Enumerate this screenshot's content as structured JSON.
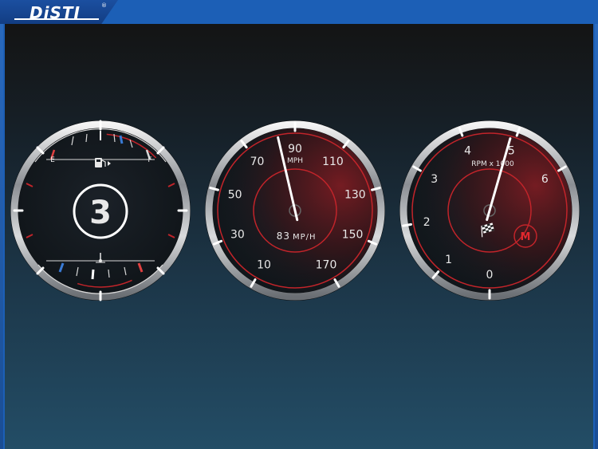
{
  "app": {
    "logo_text": "DiSTI",
    "logo_reg": "®"
  },
  "fuel_temp_gauge": {
    "fuel_empty_label": "E",
    "fuel_full_label": "F",
    "fuel_icon": "fuel-pump-icon",
    "temp_icon": "coolant-temperature-icon",
    "gear": "3"
  },
  "speedometer": {
    "unit_label": "MPH",
    "scale_labels": [
      "10",
      "30",
      "50",
      "70",
      "90",
      "110",
      "130",
      "150",
      "170"
    ],
    "readout_value": "83",
    "readout_unit": "MP/H",
    "speed": 83,
    "min": 0,
    "max": 180
  },
  "tachometer": {
    "unit_label": "RPM x 1000",
    "scale_labels": [
      "0",
      "1",
      "2",
      "3",
      "4",
      "5",
      "6"
    ],
    "rpm": 4.9,
    "min": 0,
    "max": 7,
    "mode_badge": "M",
    "flag_icon": "checkered-flag-icon"
  },
  "colors": {
    "accent_red": "#d0242a",
    "needle": "#ffffff",
    "cold_blue": "#3a7bd5"
  }
}
